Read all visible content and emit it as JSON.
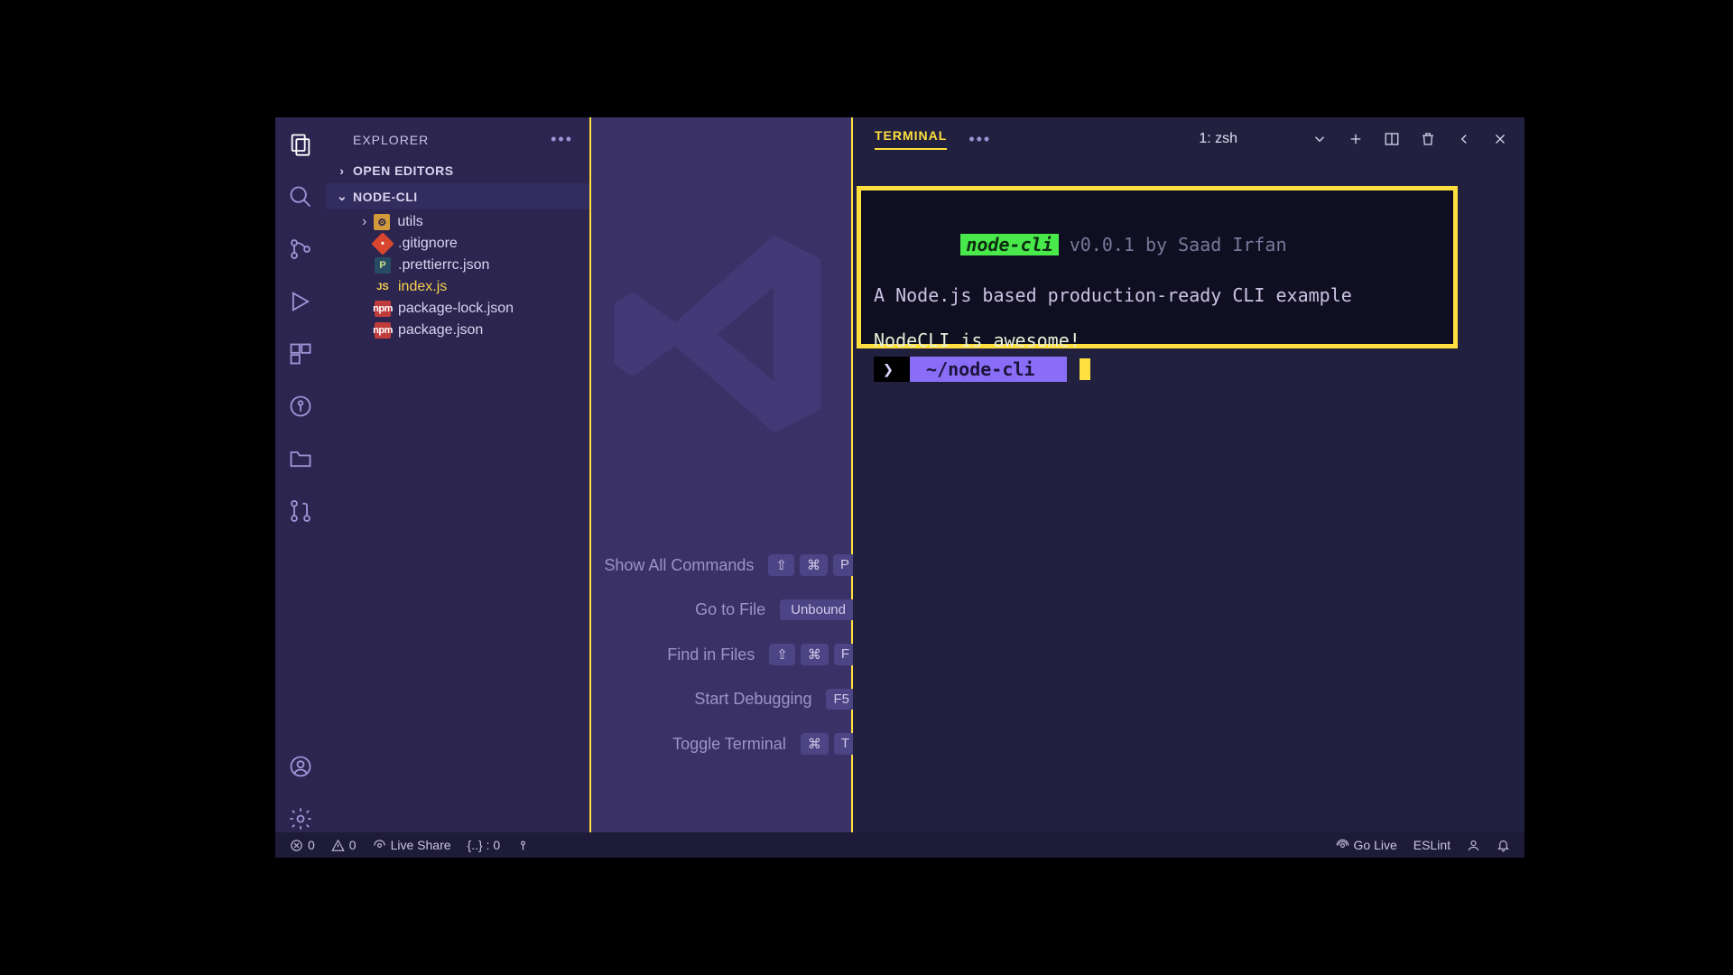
{
  "sidebar": {
    "title": "EXPLORER",
    "open_editors": "OPEN EDITORS",
    "project": "NODE-CLI",
    "tree": {
      "folder_utils": "utils",
      "gitignore": ".gitignore",
      "prettierrc": ".prettierrc.json",
      "indexjs": "index.js",
      "pkglock": "package-lock.json",
      "pkg": "package.json"
    }
  },
  "welcome": {
    "show_all": "Show All Commands",
    "go_to_file": "Go to File",
    "find_in_files": "Find in Files",
    "start_debugging": "Start Debugging",
    "toggle_terminal": "Toggle Terminal",
    "kbd_shift": "⇧",
    "kbd_cmd": "⌘",
    "kbd_p": "P",
    "kbd_f": "F",
    "kbd_unbound": "Unbound",
    "kbd_f5": "F5",
    "kbd_t": "T"
  },
  "panel": {
    "tab_terminal": "TERMINAL",
    "shell_label": "1: zsh"
  },
  "terminal": {
    "badge": "node-cli",
    "version": " v0.0.1 ",
    "byline": "by Saad Irfan",
    "desc": "A Node.js based production-ready CLI example",
    "msg": "NodeCLI is awesome!",
    "prompt_arrow": "❯",
    "prompt_path": "~/node-cli"
  },
  "status": {
    "errors": "0",
    "warnings": "0",
    "liveshare": "Live Share",
    "prettier": "{..} : 0",
    "golive": "Go Live",
    "eslint": "ESLint"
  }
}
